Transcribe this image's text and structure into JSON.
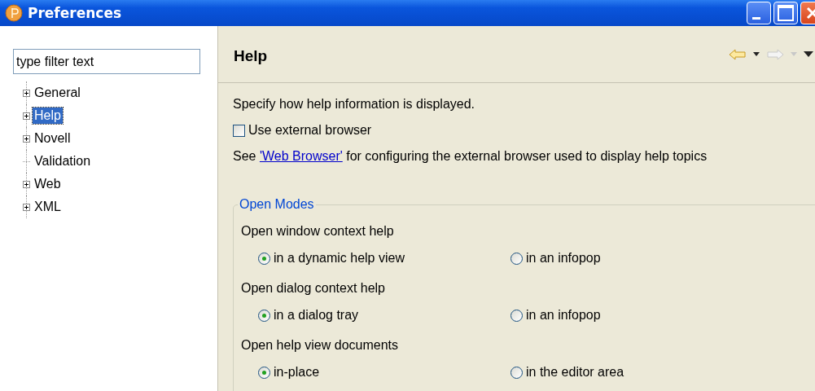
{
  "window": {
    "title": "Preferences"
  },
  "filter": {
    "value": "type filter text"
  },
  "tree": [
    {
      "label": "General",
      "expandable": true,
      "selected": false
    },
    {
      "label": "Help",
      "expandable": true,
      "selected": true
    },
    {
      "label": "Novell",
      "expandable": true,
      "selected": false
    },
    {
      "label": "Validation",
      "expandable": false,
      "selected": false
    },
    {
      "label": "Web",
      "expandable": true,
      "selected": false
    },
    {
      "label": "XML",
      "expandable": true,
      "selected": false
    }
  ],
  "page": {
    "title": "Help",
    "description": "Specify how help information is displayed.",
    "external_browser": {
      "label": "Use external browser",
      "checked": false
    },
    "note": {
      "before": "See ",
      "link": "'Web Browser'",
      "after": " for configuring the external browser used to display help topics"
    },
    "group": {
      "title": "Open Modes",
      "settings": [
        {
          "label": "Open window context help",
          "options": [
            {
              "label": "in a dynamic help view",
              "selected": true
            },
            {
              "label": "in an infopop",
              "selected": false
            }
          ]
        },
        {
          "label": "Open dialog context help",
          "options": [
            {
              "label": "in a dialog tray",
              "selected": true
            },
            {
              "label": "in an infopop",
              "selected": false
            }
          ]
        },
        {
          "label": "Open help view documents",
          "options": [
            {
              "label": "in-place",
              "selected": true
            },
            {
              "label": "in the editor area",
              "selected": false
            }
          ]
        }
      ]
    }
  }
}
